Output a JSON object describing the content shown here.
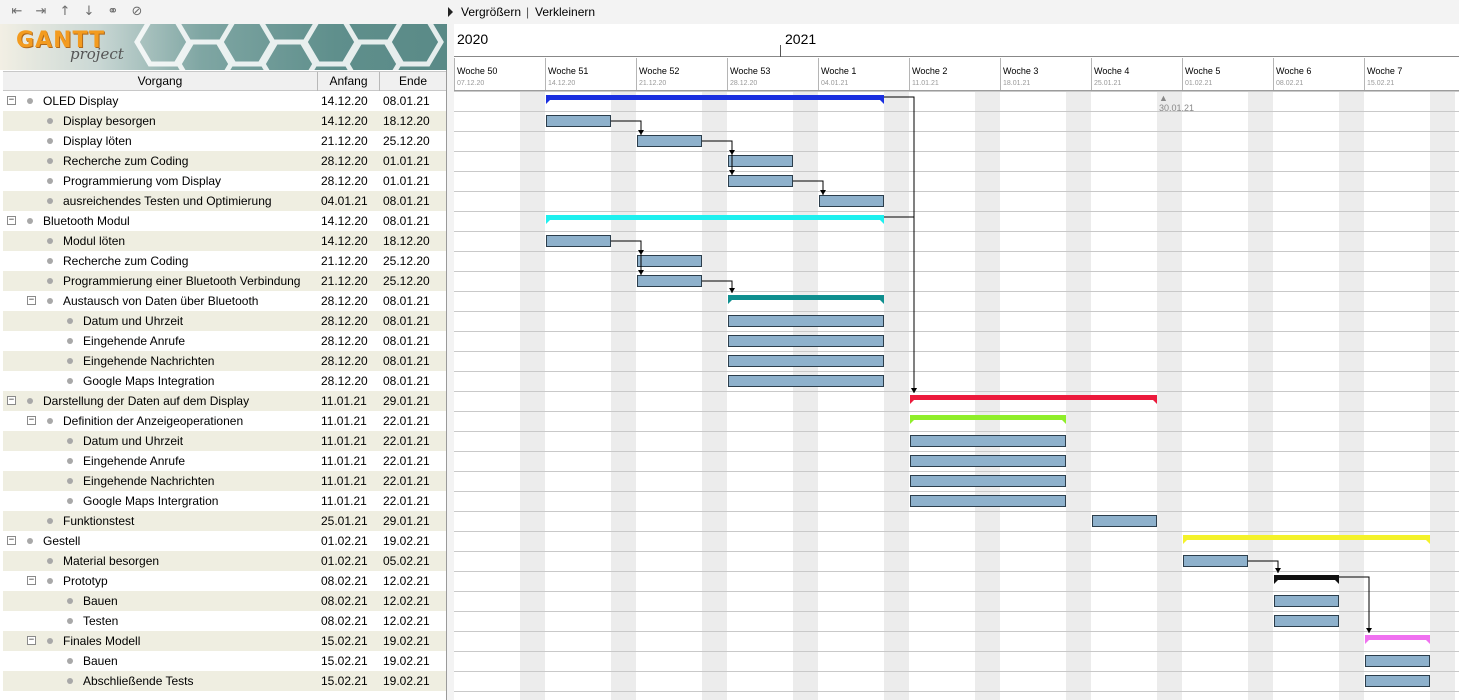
{
  "toolbar": {
    "icons": [
      "unindent-icon",
      "indent-icon",
      "move-up-icon",
      "move-down-icon",
      "link-icon",
      "unlink-icon"
    ]
  },
  "logo": {
    "brand": "GANTT",
    "sub": "project"
  },
  "table": {
    "headers": {
      "name": "Vorgang",
      "start": "Anfang",
      "end": "Ende"
    },
    "rows": [
      {
        "name": "OLED Display",
        "start": "14.12.20",
        "end": "08.01.21",
        "level": 0,
        "group": true
      },
      {
        "name": "Display besorgen",
        "start": "14.12.20",
        "end": "18.12.20",
        "level": 1,
        "group": false
      },
      {
        "name": "Display löten",
        "start": "21.12.20",
        "end": "25.12.20",
        "level": 1,
        "group": false
      },
      {
        "name": "Recherche zum Coding",
        "start": "28.12.20",
        "end": "01.01.21",
        "level": 1,
        "group": false
      },
      {
        "name": "Programmierung vom Display",
        "start": "28.12.20",
        "end": "01.01.21",
        "level": 1,
        "group": false
      },
      {
        "name": "ausreichendes Testen und Optimierung",
        "start": "04.01.21",
        "end": "08.01.21",
        "level": 1,
        "group": false
      },
      {
        "name": "Bluetooth Modul",
        "start": "14.12.20",
        "end": "08.01.21",
        "level": 0,
        "group": true
      },
      {
        "name": "Modul löten",
        "start": "14.12.20",
        "end": "18.12.20",
        "level": 1,
        "group": false
      },
      {
        "name": "Recherche zum Coding",
        "start": "21.12.20",
        "end": "25.12.20",
        "level": 1,
        "group": false
      },
      {
        "name": "Programmierung einer Bluetooth Verbindung",
        "start": "21.12.20",
        "end": "25.12.20",
        "level": 1,
        "group": false
      },
      {
        "name": "Austausch von Daten über Bluetooth",
        "start": "28.12.20",
        "end": "08.01.21",
        "level": 1,
        "group": true
      },
      {
        "name": "Datum und Uhrzeit",
        "start": "28.12.20",
        "end": "08.01.21",
        "level": 2,
        "group": false
      },
      {
        "name": "Eingehende Anrufe",
        "start": "28.12.20",
        "end": "08.01.21",
        "level": 2,
        "group": false
      },
      {
        "name": "Eingehende Nachrichten",
        "start": "28.12.20",
        "end": "08.01.21",
        "level": 2,
        "group": false
      },
      {
        "name": "Google Maps Integration",
        "start": "28.12.20",
        "end": "08.01.21",
        "level": 2,
        "group": false
      },
      {
        "name": "Darstellung der Daten auf dem Display",
        "start": "11.01.21",
        "end": "29.01.21",
        "level": 0,
        "group": true
      },
      {
        "name": "Definition der Anzeigeoperationen",
        "start": "11.01.21",
        "end": "22.01.21",
        "level": 1,
        "group": true
      },
      {
        "name": "Datum und Uhrzeit",
        "start": "11.01.21",
        "end": "22.01.21",
        "level": 2,
        "group": false
      },
      {
        "name": "Eingehende Anrufe",
        "start": "11.01.21",
        "end": "22.01.21",
        "level": 2,
        "group": false
      },
      {
        "name": "Eingehende Nachrichten",
        "start": "11.01.21",
        "end": "22.01.21",
        "level": 2,
        "group": false
      },
      {
        "name": "Google Maps Intergration",
        "start": "11.01.21",
        "end": "22.01.21",
        "level": 2,
        "group": false
      },
      {
        "name": "Funktionstest",
        "start": "25.01.21",
        "end": "29.01.21",
        "level": 1,
        "group": false
      },
      {
        "name": "Gestell",
        "start": "01.02.21",
        "end": "19.02.21",
        "level": 0,
        "group": true
      },
      {
        "name": "Material besorgen",
        "start": "01.02.21",
        "end": "05.02.21",
        "level": 1,
        "group": false
      },
      {
        "name": "Prototyp",
        "start": "08.02.21",
        "end": "12.02.21",
        "level": 1,
        "group": true
      },
      {
        "name": "Bauen",
        "start": "08.02.21",
        "end": "12.02.21",
        "level": 2,
        "group": false
      },
      {
        "name": "Testen",
        "start": "08.02.21",
        "end": "12.02.21",
        "level": 2,
        "group": false
      },
      {
        "name": "Finales Modell",
        "start": "15.02.21",
        "end": "19.02.21",
        "level": 1,
        "group": true
      },
      {
        "name": "Bauen",
        "start": "15.02.21",
        "end": "19.02.21",
        "level": 2,
        "group": false
      },
      {
        "name": "Abschließende Tests",
        "start": "15.02.21",
        "end": "19.02.21",
        "level": 2,
        "group": false
      }
    ]
  },
  "chart_toolbar": {
    "zoom_in": "Vergrößern",
    "separator": "|",
    "zoom_out": "Verkleinern"
  },
  "timeline": {
    "years": [
      "2020",
      "2021"
    ],
    "weeks": [
      {
        "label": "Woche 50",
        "date": "07.12.20"
      },
      {
        "label": "Woche 51",
        "date": "14.12.20"
      },
      {
        "label": "Woche 52",
        "date": "21.12.20"
      },
      {
        "label": "Woche 53",
        "date": "28.12.20"
      },
      {
        "label": "Woche 1",
        "date": "04.01.21"
      },
      {
        "label": "Woche 2",
        "date": "11.01.21"
      },
      {
        "label": "Woche 3",
        "date": "18.01.21"
      },
      {
        "label": "Woche 4",
        "date": "25.01.21"
      },
      {
        "label": "Woche 5",
        "date": "01.02.21"
      },
      {
        "label": "Woche 6",
        "date": "08.02.21"
      },
      {
        "label": "Woche 7",
        "date": "15.02.21"
      }
    ]
  },
  "deadline": {
    "label": "30.01.21"
  },
  "bars": [
    {
      "row": 0,
      "start": "14.12.20",
      "end": "08.01.21",
      "kind": "summary",
      "color": "#1a2fe0"
    },
    {
      "row": 1,
      "start": "14.12.20",
      "end": "18.12.20",
      "kind": "task"
    },
    {
      "row": 2,
      "start": "21.12.20",
      "end": "25.12.20",
      "kind": "task"
    },
    {
      "row": 3,
      "start": "28.12.20",
      "end": "01.01.21",
      "kind": "task"
    },
    {
      "row": 4,
      "start": "28.12.20",
      "end": "01.01.21",
      "kind": "task"
    },
    {
      "row": 5,
      "start": "04.01.21",
      "end": "08.01.21",
      "kind": "task"
    },
    {
      "row": 6,
      "start": "14.12.20",
      "end": "08.01.21",
      "kind": "summary",
      "color": "#1ef0ef"
    },
    {
      "row": 7,
      "start": "14.12.20",
      "end": "18.12.20",
      "kind": "task"
    },
    {
      "row": 8,
      "start": "21.12.20",
      "end": "25.12.20",
      "kind": "task"
    },
    {
      "row": 9,
      "start": "21.12.20",
      "end": "25.12.20",
      "kind": "task"
    },
    {
      "row": 10,
      "start": "28.12.20",
      "end": "08.01.21",
      "kind": "summary",
      "color": "#0f8f8f"
    },
    {
      "row": 11,
      "start": "28.12.20",
      "end": "08.01.21",
      "kind": "task"
    },
    {
      "row": 12,
      "start": "28.12.20",
      "end": "08.01.21",
      "kind": "task"
    },
    {
      "row": 13,
      "start": "28.12.20",
      "end": "08.01.21",
      "kind": "task"
    },
    {
      "row": 14,
      "start": "28.12.20",
      "end": "08.01.21",
      "kind": "task"
    },
    {
      "row": 15,
      "start": "11.01.21",
      "end": "29.01.21",
      "kind": "summary",
      "color": "#ec1a3c"
    },
    {
      "row": 16,
      "start": "11.01.21",
      "end": "22.01.21",
      "kind": "summary",
      "color": "#8fee2a"
    },
    {
      "row": 17,
      "start": "11.01.21",
      "end": "22.01.21",
      "kind": "task"
    },
    {
      "row": 18,
      "start": "11.01.21",
      "end": "22.01.21",
      "kind": "task"
    },
    {
      "row": 19,
      "start": "11.01.21",
      "end": "22.01.21",
      "kind": "task"
    },
    {
      "row": 20,
      "start": "11.01.21",
      "end": "22.01.21",
      "kind": "task"
    },
    {
      "row": 21,
      "start": "25.01.21",
      "end": "29.01.21",
      "kind": "task"
    },
    {
      "row": 22,
      "start": "01.02.21",
      "end": "19.02.21",
      "kind": "summary",
      "color": "#f4f22a"
    },
    {
      "row": 23,
      "start": "01.02.21",
      "end": "05.02.21",
      "kind": "task"
    },
    {
      "row": 24,
      "start": "08.02.21",
      "end": "12.02.21",
      "kind": "summary",
      "color": "#111111"
    },
    {
      "row": 25,
      "start": "08.02.21",
      "end": "12.02.21",
      "kind": "task"
    },
    {
      "row": 26,
      "start": "08.02.21",
      "end": "12.02.21",
      "kind": "task"
    },
    {
      "row": 27,
      "start": "15.02.21",
      "end": "19.02.21",
      "kind": "summary",
      "color": "#f071f0"
    },
    {
      "row": 28,
      "start": "15.02.21",
      "end": "19.02.21",
      "kind": "task"
    },
    {
      "row": 29,
      "start": "15.02.21",
      "end": "19.02.21",
      "kind": "task"
    }
  ],
  "dependencies": [
    [
      1,
      2
    ],
    [
      2,
      3
    ],
    [
      2,
      4
    ],
    [
      4,
      5
    ],
    [
      0,
      15
    ],
    [
      6,
      15
    ],
    [
      7,
      8
    ],
    [
      7,
      9
    ],
    [
      9,
      10
    ],
    [
      23,
      24
    ],
    [
      24,
      27
    ]
  ],
  "colors": {
    "task_fill": "#8eb1cc",
    "task_border": "#2c3e4c",
    "row_shade": "#efeee1",
    "weekend": "#ececec"
  }
}
